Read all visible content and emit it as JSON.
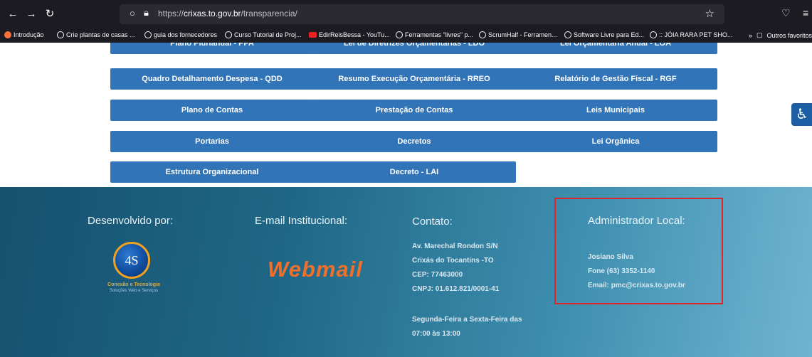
{
  "browser": {
    "url_base": "https://",
    "url_domain": "crixas.to.gov.br",
    "url_path": "/transparencia/",
    "bookmarks": [
      "Introdução",
      "Crie plantas de casas ...",
      "guia dos fornecedores",
      "Curso Tutorial de Proj...",
      "EdirReisBessa - YouTu...",
      "Ferramentas \"livres\" p...",
      "ScrumHalf - Ferramen...",
      "Software Livre para Ed...",
      ":: JÓIA RARA PET SHO..."
    ],
    "other_bookmarks": "Outros favoritos"
  },
  "buttons": {
    "row0": [
      "Plano Plurianual - PPA",
      "Lei de Diretrizes Orçamentárias - LDO",
      "Lei Orçamentária Anual - LOA"
    ],
    "row1": [
      "Quadro Detalhamento Despesa - QDD",
      "Resumo Execução Orçamentária - RREO",
      "Relatório de Gestão Fiscal - RGF"
    ],
    "row2": [
      "Plano de Contas",
      "Prestação de Contas",
      "Leis Municipais"
    ],
    "row3": [
      "Portarias",
      "Decretos",
      "Lei Orgânica"
    ],
    "row4": [
      "Estrutura Organizacional",
      "Decreto - LAI"
    ]
  },
  "footer": {
    "dev_title": "Desenvolvido por:",
    "logo_text": "4S",
    "logo_name": "Conexão e Tecnologia",
    "logo_sub": "Soluções Web e Serviços",
    "email_title": "E-mail Institucional:",
    "webmail_label": "Webmail",
    "contact_title": "Contato:",
    "contact_lines": [
      "Av. Marechal Rondon S/N",
      "Crixás do Tocantins -TO",
      "CEP: 77463000",
      "CNPJ: 01.612.821/0001-41"
    ],
    "hours_lines": [
      "Segunda-Feira a Sexta-Feira das",
      "07:00 às 13:00"
    ],
    "admin_title": "Administrador Local:",
    "admin_lines": [
      "Josiano Silva",
      "Fone (63) 3352-1140",
      "Email: pmc@crixas.to.gov.br"
    ]
  },
  "colors": {
    "button_blue": "#3174b8",
    "highlight_red": "#e1262b",
    "webmail_orange": "#f06f2a"
  }
}
